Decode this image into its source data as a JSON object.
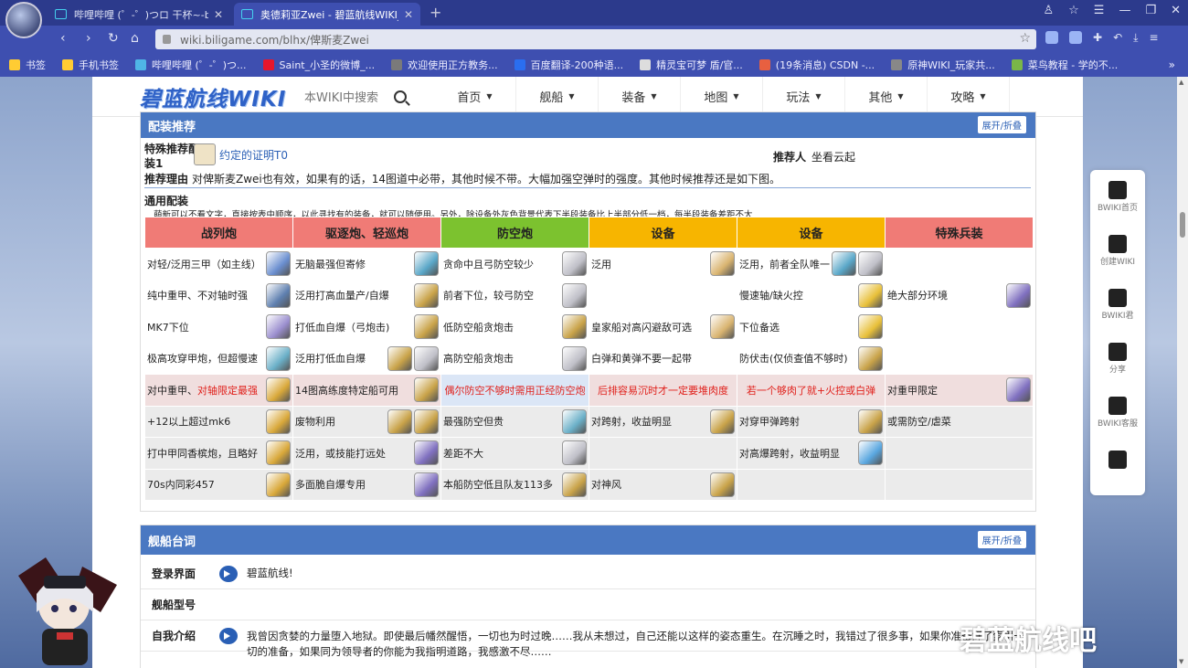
{
  "browser": {
    "tabs": [
      {
        "title": "哔哩哔哩 (゜-゜)つロ 干杯~-bilibili"
      },
      {
        "title": "奥德莉亚Zwei - 碧蓝航线WIKI_BWIKI_哔哩哔哩"
      }
    ],
    "new_tab": "+",
    "url": "wiki.biligame.com/blhx/俾斯麦Zwei",
    "bookmarks": [
      "书签",
      "手机书签",
      "哔哩哔哩 (゜-゜)つ...",
      "Saint_小圣的微博_...",
      "欢迎使用正方教务...",
      "百度翻译-200种语...",
      "精灵宝可梦 盾/官...",
      "(19条消息) CSDN -...",
      "原神WIKI_玩家共...",
      "菜鸟教程 - 学的不..."
    ],
    "bookmark_colors": [
      "#ffcc33",
      "#ffcc33",
      "#4fb5e6",
      "#e6162d",
      "#7a7a7a",
      "#2a6ef0",
      "#ddd",
      "#e86040",
      "#888",
      "#7ab648"
    ]
  },
  "wiki": {
    "logo": "碧蓝航线WIKI",
    "search_placeholder": "本WIKI中搜索",
    "menu": [
      "首页",
      "舰船",
      "装备",
      "地图",
      "玩法",
      "其他",
      "攻略"
    ]
  },
  "equip_section": {
    "title": "配装推荐",
    "toggle": "展开/折叠",
    "special_label": "特殊推荐配装1",
    "special_item": "约定的证明T0",
    "recommender_label": "推荐人",
    "recommender": "坐看云起",
    "reason_label": "推荐理由",
    "reason": "对俾斯麦Zwei也有效，如果有的话，14图道中必带，其他时候不带。大幅加强空弹时的强度。其他时候推荐还是如下图。",
    "general_label": "通用配装",
    "note": "萌新可以不看文字，直接按表中顺序，以此寻找有的装备，就可以随便用。另外，除设备外灰色背景代表下半段装备比上半部分低一档，每半段装备差距不大",
    "headers": [
      {
        "label": "战列炮",
        "color": "#f07b76"
      },
      {
        "label": "驱逐炮、轻巡炮",
        "color": "#f07b76"
      },
      {
        "label": "防空炮",
        "color": "#7cc22f"
      },
      {
        "label": "设备",
        "color": "#f7b500"
      },
      {
        "label": "设备",
        "color": "#f7b500"
      },
      {
        "label": "特殊兵装",
        "color": "#f07b76"
      }
    ],
    "rows": [
      [
        {
          "t": "对轻/泛用三甲（如主线）",
          "i": [
            "#6b8fd0"
          ]
        },
        {
          "t": "无脑最强但寄修",
          "i": [
            "#5aa7c8"
          ]
        },
        {
          "t": "贪命中且弓防空较少",
          "i": [
            "#c0c0c8"
          ]
        },
        {
          "t": "泛用",
          "i": [
            "#d9b470"
          ]
        },
        {
          "t": "泛用，前者全队唯一",
          "i": [
            "#5aa7c8",
            "#c0c0c8"
          ]
        },
        {
          "t": "",
          "i": []
        }
      ],
      [
        {
          "t": "纯中重甲、不对轴时强",
          "i": [
            "#5f80b0"
          ]
        },
        {
          "t": "泛用打高血量产/自爆",
          "i": [
            "#c9a349"
          ]
        },
        {
          "t": "前者下位，较弓防空",
          "i": [
            "#c0c0c8"
          ]
        },
        {
          "t": "",
          "i": []
        },
        {
          "t": "慢速轴/缺火控",
          "i": [
            "#e8c03a"
          ]
        },
        {
          "t": "绝大部分环境",
          "i": [
            "#8070c0"
          ]
        }
      ],
      [
        {
          "t": "MK7下位",
          "i": [
            "#9b8fcf"
          ]
        },
        {
          "t": "打低血自爆（弓炮击)",
          "i": [
            "#c9a349"
          ]
        },
        {
          "t": "低防空船贪炮击",
          "i": [
            "#c9a349"
          ]
        },
        {
          "t": "皇家船对高闪避敌可选",
          "i": [
            "#d9b470"
          ]
        },
        {
          "t": "下位备选",
          "i": [
            "#e8c03a"
          ]
        },
        {
          "t": "",
          "i": []
        }
      ],
      [
        {
          "t": "极高攻穿甲炮，但超慢速",
          "i": [
            "#6bb0c8"
          ]
        },
        {
          "t": "泛用打低血自爆",
          "i": [
            "#c9a349",
            "#c0c0c8"
          ]
        },
        {
          "t": "高防空船贪炮击",
          "i": [
            "#c0c0c8"
          ]
        },
        {
          "t": "白弹和黄弹不要一起带",
          "i": []
        },
        {
          "t": "防伏击(仅侦查值不够时)",
          "i": [
            "#c9a349"
          ]
        },
        {
          "t": "",
          "i": []
        }
      ],
      [
        {
          "t": "对中重甲、",
          "r": "对轴限定最强",
          "i": [
            "#d9a83a"
          ]
        },
        {
          "t": "14图高练度特定船可用",
          "i": [
            "#c9a349"
          ]
        },
        {
          "t": "",
          "r": "偶尔防空不够时需用正经防空炮",
          "i": []
        },
        {
          "t": "",
          "r": "后排容易沉时才一定要堆肉度",
          "i": []
        },
        {
          "t": "",
          "r": "若一个够肉了就+火控或白弹",
          "i": []
        },
        {
          "t": "对重甲限定",
          "i": [
            "#8070c0"
          ]
        }
      ],
      [
        {
          "t": "+12以上超过mk6",
          "i": [
            "#d9a83a"
          ]
        },
        {
          "t": "废物利用",
          "i": [
            "#c9a349",
            "#c9a349"
          ]
        },
        {
          "t": "最强防空但贵",
          "i": [
            "#6bb0c8"
          ]
        },
        {
          "t": "对跨射，收益明显",
          "i": [
            "#c9a349"
          ]
        },
        {
          "t": "对穿甲弹跨射",
          "i": [
            "#c9a349"
          ]
        },
        {
          "t": "或需防空/虐菜",
          "i": []
        }
      ],
      [
        {
          "t": "打中甲同香槟炮，且略好",
          "i": [
            "#d9a83a"
          ]
        },
        {
          "t": "泛用，或技能打远处",
          "i": [
            "#8070c0"
          ]
        },
        {
          "t": "差距不大",
          "i": [
            "#c0c0c8"
          ]
        },
        {
          "t": "",
          "i": []
        },
        {
          "t": "对高爆跨射，收益明显",
          "i": [
            "#5aa7e0"
          ]
        },
        {
          "t": "",
          "i": []
        }
      ],
      [
        {
          "t": "70s内同彩457",
          "i": [
            "#d9a83a"
          ]
        },
        {
          "t": "多面脆自爆专用",
          "i": [
            "#8070c0"
          ]
        },
        {
          "t": "本船防空低且队友113多",
          "i": [
            "#c9a349"
          ]
        },
        {
          "t": "对神风",
          "i": [
            "#c9a349"
          ]
        },
        {
          "t": "",
          "i": []
        },
        {
          "t": "",
          "i": []
        }
      ]
    ],
    "row_bg": [
      [
        "",
        "",
        "",
        "",
        "",
        ""
      ],
      [
        "",
        "",
        "",
        "",
        "",
        ""
      ],
      [
        "",
        "",
        "",
        "",
        "",
        ""
      ],
      [
        "",
        "",
        "",
        "",
        "",
        ""
      ],
      [
        "pink",
        "pink",
        "blue",
        "pink",
        "pink",
        "pink"
      ],
      [
        "gray",
        "gray",
        "gray",
        "gray",
        "gray",
        "gray"
      ],
      [
        "gray",
        "gray",
        "gray",
        "gray",
        "gray",
        "gray"
      ],
      [
        "gray",
        "gray",
        "gray",
        "gray",
        "gray",
        "gray"
      ]
    ]
  },
  "lines_section": {
    "title": "舰船台词",
    "toggle": "展开/折叠",
    "rows": [
      {
        "label": "登录界面",
        "voice": true,
        "text": "碧蓝航线!"
      },
      {
        "label": "舰船型号",
        "voice": false,
        "text": ""
      },
      {
        "label": "自我介绍",
        "voice": true,
        "text": "我曾因贪婪的力量堕入地狱。即使最后幡然醒悟，一切也为时过晚……我从未想过，自己还能以这样的姿态重生。在沉睡之时，我错过了很多事，如果你准备好了索引一切的准备，如果同为领导者的你能为我指明道路，我感激不尽……"
      }
    ]
  },
  "sidebar": {
    "items": [
      "BWIKI首页",
      "创建WIKI",
      "BWIKI君",
      "分享",
      "BWIKI客服",
      ""
    ]
  },
  "watermark": "碧蓝航线吧"
}
